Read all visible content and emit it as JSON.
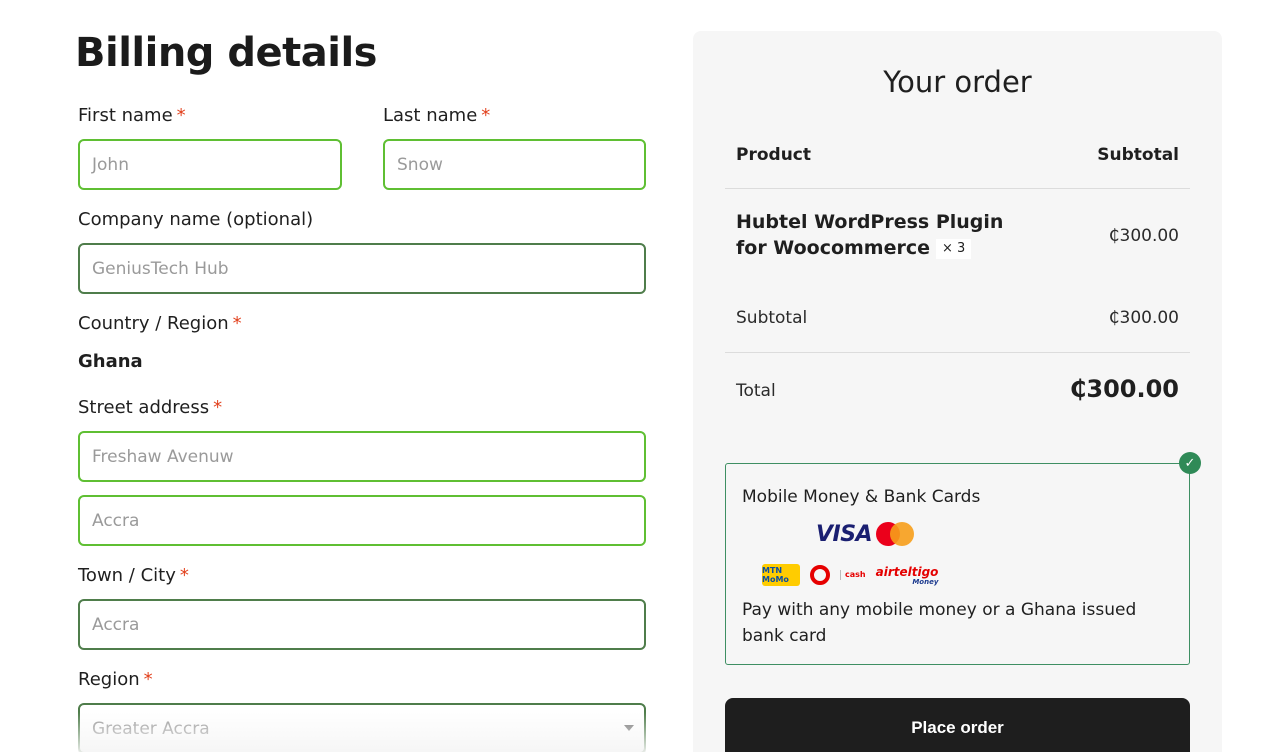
{
  "billing": {
    "title": "Billing details",
    "required_mark": "*",
    "first_name": {
      "label": "First name",
      "value": "John"
    },
    "last_name": {
      "label": "Last name",
      "value": "Snow"
    },
    "company": {
      "label": "Company name (optional)",
      "value": "GeniusTech Hub"
    },
    "country": {
      "label": "Country / Region",
      "value": "Ghana"
    },
    "street": {
      "label": "Street address",
      "line1": "Freshaw Avenuw",
      "line2": "Accra"
    },
    "town": {
      "label": "Town / City",
      "value": "Accra"
    },
    "region": {
      "label": "Region",
      "value": "Greater Accra"
    }
  },
  "order": {
    "title": "Your order",
    "col_product": "Product",
    "col_subtotal": "Subtotal",
    "items": [
      {
        "name": "Hubtel WordPress Plugin for Woocommerce",
        "qty": "× 3",
        "amount": "₵300.00"
      }
    ],
    "subtotal_label": "Subtotal",
    "subtotal_value": "₵300.00",
    "total_label": "Total",
    "total_value": "₵300.00",
    "payment": {
      "title": "Mobile Money & Bank Cards",
      "logos": {
        "visa": "VISA",
        "mtn": "MTN MoMo",
        "vodafone_cash": "cash",
        "airteltigo": "airteltigo",
        "airteltigo_money": "Money"
      },
      "description": "Pay with any mobile money or a Ghana issued bank card",
      "check_mark": "✓",
      "icons": [
        "check-icon",
        "visa-logo",
        "mastercard-logo",
        "mtn-momo-logo",
        "vodafone-cash-logo",
        "airteltigo-money-logo"
      ]
    },
    "place_order_label": "Place order"
  },
  "colors": {
    "field_border_active": "#5fbf33",
    "field_border_dark": "#4f7d4b",
    "required": "#e2401c",
    "panel_bg": "#f6f6f6",
    "payment_border": "#3e8f63",
    "button_bg": "#1e1e1e"
  }
}
